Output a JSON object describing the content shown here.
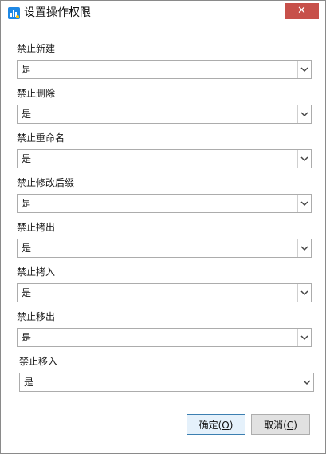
{
  "window": {
    "title": "设置操作权限",
    "close_label": "✕"
  },
  "fields": [
    {
      "label": "禁止新建",
      "value": "是"
    },
    {
      "label": "禁止删除",
      "value": "是"
    },
    {
      "label": "禁止重命名",
      "value": "是"
    },
    {
      "label": "禁止修改后缀",
      "value": "是"
    },
    {
      "label": "禁止拷出",
      "value": "是"
    },
    {
      "label": "禁止拷入",
      "value": "是"
    },
    {
      "label": "禁止移出",
      "value": "是"
    },
    {
      "label": "禁止移入",
      "value": "是"
    }
  ],
  "buttons": {
    "ok_text": "确定(",
    "ok_key": "O",
    "ok_close": ")",
    "cancel_text": "取消(",
    "cancel_key": "C",
    "cancel_close": ")"
  },
  "colors": {
    "close_button": "#c7504a",
    "app_icon": "#1e88e5",
    "ok_border": "#3c7fb1"
  },
  "icons": {
    "app": "bar-chart-icon",
    "close": "close-icon",
    "dropdown": "chevron-down-icon"
  }
}
